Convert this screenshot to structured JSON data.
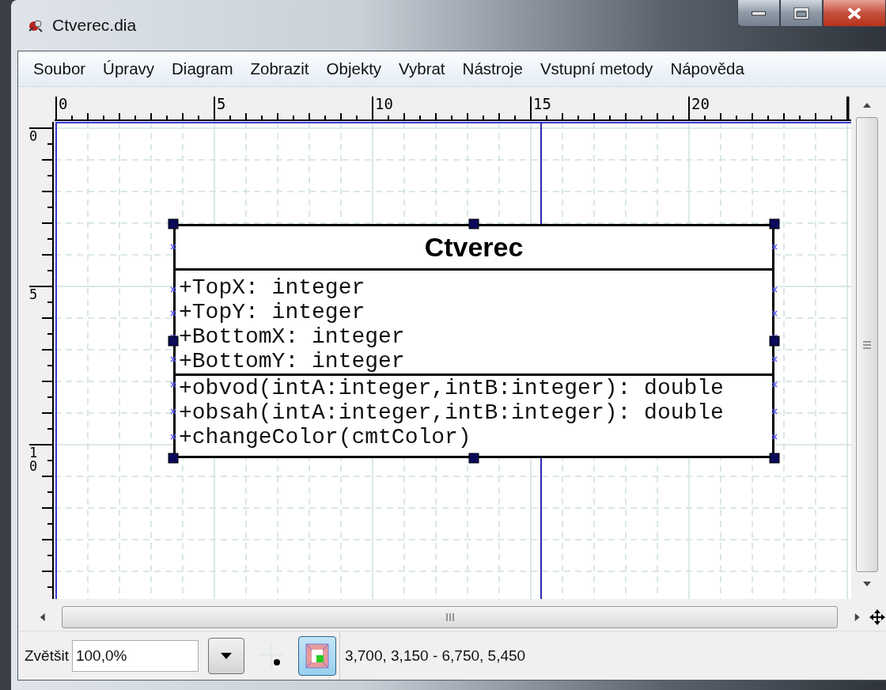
{
  "window": {
    "title": "Ctverec.dia"
  },
  "menu": [
    {
      "label": "Soubor"
    },
    {
      "label": "Úpravy"
    },
    {
      "label": "Diagram"
    },
    {
      "label": "Zobrazit"
    },
    {
      "label": "Objekty"
    },
    {
      "label": "Vybrat"
    },
    {
      "label": "Nástroje"
    },
    {
      "label": "Vstupní metody"
    },
    {
      "label": "Nápověda"
    }
  ],
  "rulers": {
    "horizontal": [
      "0",
      "5",
      "10",
      "15",
      "20"
    ],
    "vertical": [
      "0",
      "5",
      "10"
    ]
  },
  "diagram": {
    "class": {
      "name": "Ctverec",
      "selected": true,
      "attributes": [
        "+TopX: integer",
        "+TopY: integer",
        "+BottomX: integer",
        "+BottomY: integer"
      ],
      "operations": [
        "+obvod(intA:integer,intB:integer): double",
        "+obsah(intA:integer,intB:integer): double",
        "+changeColor(cmtColor)"
      ]
    }
  },
  "status_bar": {
    "zoom_label": "Zvětšit",
    "zoom_value": "100,0%",
    "toggles": [
      {
        "kind": "grid",
        "pressed": false
      },
      {
        "kind": "snap",
        "pressed": true
      }
    ],
    "selection": "3,700, 3,150 - 6,750, 5,450"
  }
}
